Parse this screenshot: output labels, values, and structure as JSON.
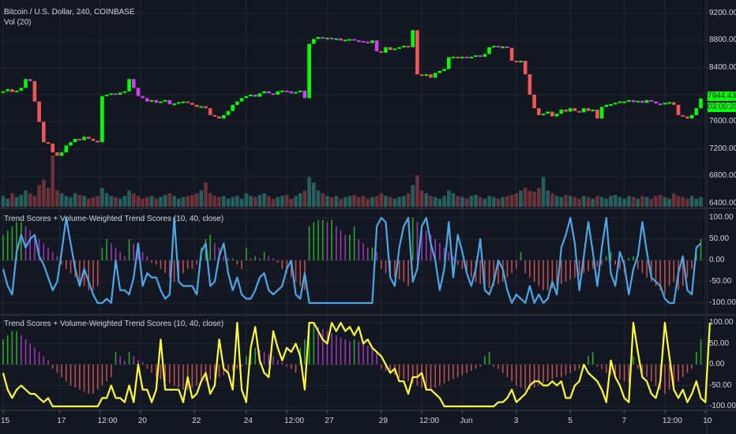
{
  "header": {
    "symbol_title": "Bitcoin / U.S. Dollar, 240, COINBASE",
    "volume_legend": "Vol (20)"
  },
  "panes": [
    {
      "legend": "Trend Scores + Volume-Weighted Trend Scores (10, 40, close)"
    },
    {
      "legend": "Trend Scores + Volume-Weighted Trend Scores (10, 40, close)"
    }
  ],
  "price_axis": {
    "labels": [
      "9200.00",
      "8800.00",
      "8400.00",
      "7600.00",
      "7200.00",
      "6800.00",
      "6400.00"
    ],
    "values": [
      9200,
      8800,
      8400,
      7600,
      7200,
      6800,
      6400
    ]
  },
  "score_axis": {
    "labels": [
      "100.00",
      "50.00",
      "0.00",
      "-50.00",
      "-100.00"
    ],
    "values": [
      100,
      50,
      0,
      -50,
      -100
    ]
  },
  "current_price": {
    "value": "7944.43",
    "countdown": "03:00:20",
    "color": "#00ff00"
  },
  "time_axis": {
    "labels": [
      "15",
      "17",
      "12:00",
      "20",
      "22",
      "24",
      "12:00",
      "27",
      "29",
      "12:00",
      "Jun",
      "3",
      "5",
      "7",
      "12:00",
      "10"
    ],
    "bar_index": [
      0,
      12.5,
      21.5,
      30.5,
      42.5,
      54,
      63,
      72,
      84,
      93,
      102,
      114,
      126,
      138,
      147,
      156
    ]
  },
  "colors": {
    "up": "#00ff00",
    "down": "#f05656",
    "pullback": "#d040f0",
    "trend_line_1": "#4aa8e8",
    "trend_line_2": "#ffff33",
    "hist_pos_rising": "#2fbf2f",
    "hist_pos_falling": "#b040c8",
    "hist_neg": "#d85a5a"
  },
  "chart_data": {
    "type": "candlestick+volume+line+histogram",
    "title": "Bitcoin / U.S. Dollar, 240, COINBASE",
    "bars": 156,
    "close": [
      8050,
      8080,
      8040,
      8060,
      8100,
      8230,
      8200,
      7900,
      7600,
      7300,
      7280,
      7150,
      7100,
      7150,
      7250,
      7300,
      7350,
      7330,
      7380,
      7350,
      7320,
      7300,
      7980,
      8000,
      8020,
      8000,
      8030,
      8050,
      8230,
      8100,
      7980,
      7950,
      7900,
      7920,
      7880,
      7900,
      7920,
      7860,
      7870,
      7890,
      7900,
      7880,
      7850,
      7820,
      7830,
      7800,
      7700,
      7680,
      7650,
      7700,
      7760,
      7850,
      7900,
      7950,
      7980,
      8000,
      7970,
      8020,
      8050,
      8020,
      8000,
      8050,
      8060,
      8050,
      8020,
      8040,
      8060,
      7950,
      8750,
      8820,
      8850,
      8830,
      8840,
      8820,
      8830,
      8800,
      8810,
      8820,
      8800,
      8790,
      8780,
      8760,
      8800,
      8640,
      8620,
      8700,
      8660,
      8680,
      8700,
      8720,
      8700,
      8950,
      8300,
      8280,
      8300,
      8250,
      8320,
      8350,
      8380,
      8550,
      8560,
      8540,
      8560,
      8550,
      8560,
      8580,
      8560,
      8600,
      8700,
      8720,
      8700,
      8710,
      8690,
      8500,
      8480,
      8500,
      8300,
      8000,
      7800,
      7700,
      7720,
      7750,
      7680,
      7720,
      7780,
      7750,
      7800,
      7760,
      7740,
      7800,
      7760,
      7780,
      7650,
      7820,
      7850,
      7860,
      7880,
      7900,
      7900,
      7920,
      7890,
      7910,
      7880,
      7920,
      7900,
      7870,
      7860,
      7880,
      7890,
      7850,
      7700,
      7680,
      7650,
      7700,
      7800,
      7944.43
    ],
    "volume": [
      20,
      15,
      25,
      18,
      22,
      30,
      25,
      20,
      40,
      50,
      35,
      95,
      30,
      25,
      20,
      18,
      25,
      22,
      20,
      15,
      18,
      20,
      35,
      25,
      20,
      18,
      15,
      20,
      30,
      25,
      20,
      15,
      18,
      20,
      15,
      18,
      22,
      25,
      20,
      15,
      18,
      20,
      22,
      25,
      30,
      45,
      25,
      20,
      18,
      20,
      15,
      18,
      20,
      15,
      25,
      20,
      18,
      22,
      25,
      20,
      15,
      18,
      20,
      22,
      15,
      20,
      25,
      30,
      55,
      45,
      30,
      25,
      20,
      18,
      20,
      15,
      18,
      20,
      22,
      18,
      20,
      15,
      18,
      20,
      25,
      20,
      18,
      15,
      18,
      20,
      25,
      40,
      58,
      30,
      25,
      20,
      18,
      15,
      20,
      30,
      25,
      20,
      18,
      15,
      20,
      22,
      18,
      15,
      20,
      18,
      15,
      18,
      20,
      22,
      25,
      30,
      35,
      30,
      28,
      35,
      55,
      30,
      25,
      20,
      18,
      22,
      20,
      18,
      15,
      20,
      18,
      15,
      20,
      18,
      15,
      20,
      22,
      18,
      15,
      20,
      18,
      15,
      20,
      18,
      15,
      20,
      22,
      18,
      15,
      25,
      20,
      18,
      15,
      20,
      15,
      18
    ],
    "trend_score": [
      -20,
      -60,
      -80,
      20,
      60,
      30,
      50,
      60,
      10,
      -10,
      -40,
      -70,
      -50,
      20,
      100,
      40,
      -20,
      -60,
      -20,
      -50,
      -80,
      -100,
      -100,
      -90,
      -100,
      0,
      -70,
      -70,
      -80,
      -40,
      40,
      -60,
      -30,
      -40,
      -40,
      -70,
      -90,
      -80,
      100,
      -50,
      -60,
      -60,
      -60,
      -80,
      20,
      40,
      -60,
      -50,
      10,
      40,
      -30,
      -70,
      -40,
      -80,
      -90,
      -90,
      -70,
      -40,
      -30,
      -70,
      -80,
      -70,
      -60,
      -20,
      0,
      -80,
      -90,
      -30,
      -100,
      -100,
      -100,
      -100,
      -100,
      -100,
      -100,
      -100,
      -100,
      -100,
      -100,
      -100,
      -100,
      -100,
      -100,
      80,
      100,
      90,
      -40,
      -60,
      30,
      80,
      100,
      -50,
      -20,
      80,
      100,
      40,
      0,
      -70,
      -20,
      90,
      -40,
      60,
      20,
      -30,
      -60,
      -20,
      50,
      -70,
      -80,
      -50,
      0,
      -20,
      -70,
      -100,
      -80,
      -90,
      -100,
      -60,
      -100,
      -80,
      -100,
      -90,
      -50,
      -80,
      30,
      60,
      100,
      40,
      -70,
      10,
      90,
      20,
      -60,
      30,
      100,
      -30,
      -60,
      20,
      -10,
      -80,
      -20,
      10,
      90,
      20,
      -40,
      -50,
      -60,
      -90,
      -100,
      -100,
      -30,
      10,
      -70,
      -80,
      30,
      40
    ],
    "trend_hist": [
      60,
      70,
      80,
      90,
      90,
      80,
      70,
      60,
      50,
      40,
      30,
      20,
      10,
      -10,
      -20,
      -30,
      -40,
      -50,
      -60,
      -70,
      -70,
      -60,
      30,
      50,
      40,
      30,
      20,
      10,
      50,
      40,
      30,
      20,
      10,
      -5,
      -10,
      -20,
      -30,
      -40,
      -50,
      -40,
      -30,
      -20,
      -20,
      -10,
      30,
      50,
      60,
      40,
      30,
      10,
      5,
      5,
      -10,
      -20,
      30,
      5,
      10,
      5,
      20,
      10,
      5,
      -5,
      -20,
      -30,
      -40,
      -50,
      -60,
      -70,
      80,
      90,
      95,
      95,
      90,
      95,
      80,
      70,
      60,
      60,
      80,
      50,
      40,
      30,
      30,
      20,
      -20,
      -30,
      -35,
      -40,
      -45,
      -50,
      -60,
      100,
      90,
      80,
      70,
      60,
      50,
      40,
      30,
      20,
      10,
      -10,
      -20,
      -30,
      -40,
      -50,
      -55,
      -60,
      -65,
      -60,
      -55,
      -50,
      -40,
      -30,
      -20,
      20,
      -30,
      -40,
      -50,
      -60,
      -70,
      -70,
      -65,
      -60,
      -55,
      -50,
      -45,
      -40,
      -35,
      -30,
      -25,
      -20,
      -15,
      -10,
      10,
      20,
      -10,
      -20,
      -30,
      5,
      10,
      -20,
      -30,
      -40,
      -50,
      -60,
      -70,
      -80,
      -60,
      -50,
      -70,
      -60,
      -40,
      -20,
      20,
      50
    ],
    "vw_trend_score": [
      -20,
      -60,
      -80,
      -60,
      -50,
      -60,
      -70,
      -70,
      -80,
      -90,
      -80,
      -100,
      -100,
      -100,
      -100,
      -100,
      -100,
      -100,
      -100,
      -100,
      -100,
      -100,
      -80,
      -80,
      -50,
      -80,
      -80,
      -90,
      -50,
      -90,
      0,
      -60,
      -60,
      -90,
      -60,
      60,
      -60,
      -60,
      -60,
      -60,
      -90,
      -30,
      -80,
      -70,
      -40,
      -20,
      -70,
      -50,
      60,
      -10,
      -20,
      -60,
      100,
      -60,
      -90,
      40,
      90,
      10,
      -20,
      -30,
      80,
      40,
      10,
      40,
      30,
      50,
      20,
      -60,
      100,
      100,
      80,
      60,
      50,
      100,
      80,
      100,
      80,
      90,
      70,
      90,
      50,
      60,
      40,
      30,
      20,
      0,
      -20,
      -10,
      -40,
      -40,
      -70,
      -30,
      -30,
      -20,
      -60,
      -60,
      -70,
      -80,
      -100,
      -100,
      -100,
      -100,
      -100,
      -100,
      -100,
      -100,
      -100,
      -100,
      -100,
      -100,
      -90,
      -90,
      -80,
      -60,
      -90,
      -80,
      -70,
      -50,
      -40,
      -40,
      -50,
      -50,
      -40,
      -50,
      -40,
      -80,
      -80,
      -50,
      -40,
      0,
      -20,
      -30,
      -40,
      -60,
      -90,
      10,
      -30,
      -50,
      -80,
      -90,
      100,
      30,
      -30,
      -40,
      -70,
      -80,
      -40,
      100,
      20,
      -60,
      -80,
      -60,
      -90,
      -70,
      -40,
      -80,
      -90,
      100
    ],
    "vw_trend_hist": [
      60,
      70,
      80,
      80,
      70,
      60,
      50,
      40,
      30,
      20,
      10,
      -10,
      -20,
      -30,
      -40,
      -50,
      -55,
      -60,
      -65,
      -70,
      -70,
      -60,
      -50,
      -40,
      -30,
      30,
      20,
      10,
      30,
      20,
      10,
      5,
      -10,
      -20,
      -30,
      -35,
      -40,
      -45,
      -50,
      -55,
      -60,
      -60,
      -55,
      -50,
      -45,
      -40,
      -35,
      -30,
      -30,
      -25,
      -20,
      -15,
      -10,
      -5,
      20,
      30,
      40,
      35,
      30,
      25,
      20,
      10,
      5,
      -5,
      -10,
      -20,
      40,
      60,
      100,
      100,
      90,
      85,
      80,
      75,
      70,
      65,
      60,
      55,
      60,
      55,
      50,
      45,
      40,
      30,
      -10,
      -15,
      -20,
      -25,
      -30,
      -35,
      -40,
      -45,
      -50,
      -55,
      -60,
      -60,
      -55,
      -50,
      -45,
      -40,
      -35,
      -30,
      -25,
      -20,
      -15,
      -10,
      -5,
      20,
      30,
      -5,
      -10,
      -20,
      -30,
      -40,
      -50,
      -55,
      -60,
      -60,
      -55,
      -50,
      -45,
      -40,
      -35,
      -30,
      -30,
      -25,
      -20,
      -15,
      -10,
      -5,
      20,
      30,
      -5,
      -10,
      -20,
      -25,
      -30,
      -35,
      -40,
      -45,
      20,
      -10,
      -20,
      -30,
      -40,
      -50,
      -60,
      -70,
      -60,
      -50,
      -40,
      -30,
      -20,
      -10,
      30,
      60
    ],
    "price_range": [
      6400,
      9200
    ],
    "score_range": [
      -100,
      100
    ]
  }
}
